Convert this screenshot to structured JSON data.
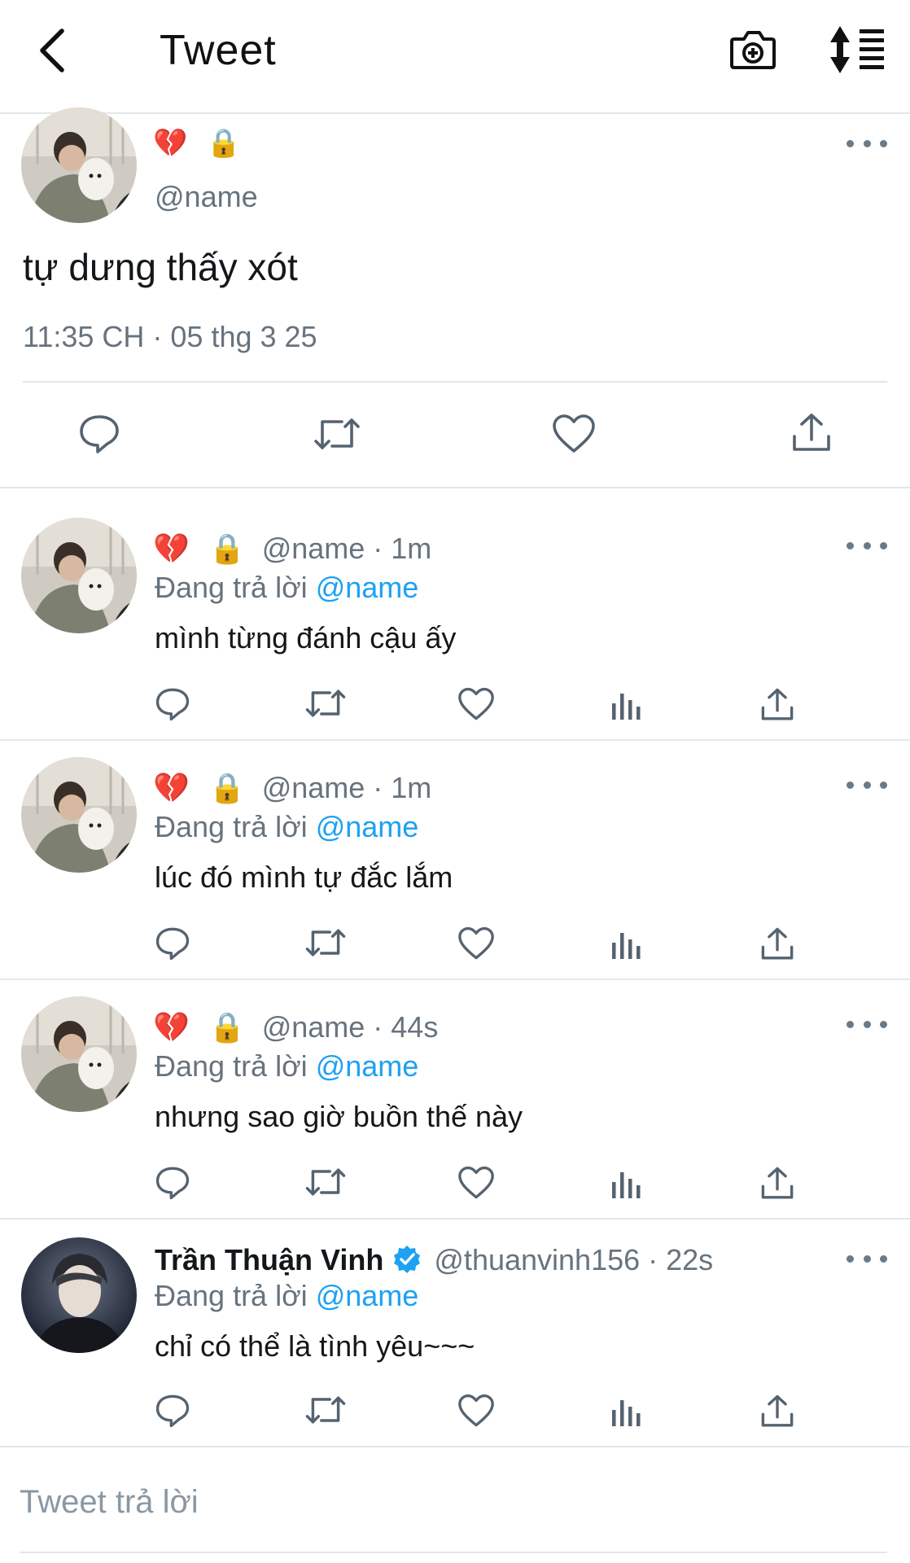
{
  "header": {
    "title": "Tweet",
    "back_icon": "chevron-left-icon",
    "camera_icon": "camera-add-icon",
    "sort_icon": "sort-list-icon"
  },
  "main_tweet": {
    "emoji_1": "💔",
    "emoji_2": "🔒",
    "handle": "@name",
    "text": "tự dưng thấy xót",
    "timestamp": "11:35 CH · 05 thg 3 25"
  },
  "replies": [
    {
      "emoji_1": "💔",
      "emoji_2": "🔒",
      "handle": "@name",
      "time": " · 1m",
      "replying_prefix": "Đang trả lời",
      "replying_to": "@name",
      "text": "mình từng đánh cậu ấy"
    },
    {
      "emoji_1": "💔",
      "emoji_2": "🔒",
      "handle": "@name",
      "time": " · 1m",
      "replying_prefix": "Đang trả lời",
      "replying_to": "@name",
      "text": "lúc đó mình tự đắc lắm"
    },
    {
      "emoji_1": "💔",
      "emoji_2": "🔒",
      "handle": "@name",
      "time": " · 44s",
      "replying_prefix": "Đang trả lời",
      "replying_to": "@name",
      "text": "nhưng sao giờ buồn thế này"
    },
    {
      "display_name": "Trần Thuận Vinh",
      "verified": true,
      "handle": "@thuanvinh156",
      "time": " · 22s",
      "replying_prefix": "Đang trả lời",
      "replying_to": "@name",
      "text": "chỉ có thể là tình yêu~~~"
    }
  ],
  "composer": {
    "placeholder": "Tweet trả lời"
  },
  "colors": {
    "accent": "#1da1f2",
    "secondary_text": "#67737e",
    "divider": "#e1e8ed"
  }
}
